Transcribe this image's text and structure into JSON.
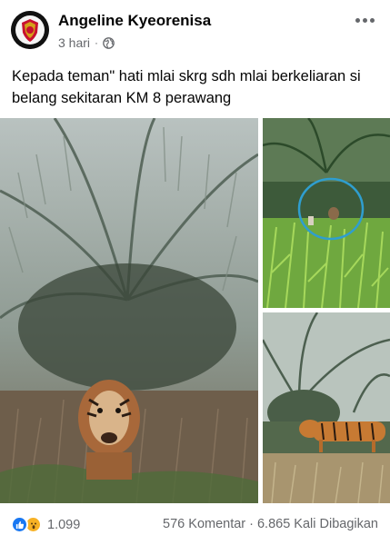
{
  "post": {
    "author": "Angeline Kyeorenisa",
    "time": "3 hari",
    "separator": "·",
    "text": "Kepada teman\" hati mlai skrg sdh mlai berkeliaran si belang sekitaran KM 8 perawang"
  },
  "icons": {
    "avatar": "police-badge-avatar",
    "privacy": "globe-icon",
    "options": "more-options-icon",
    "like": "like-reaction-icon",
    "wow": "wow-reaction-icon"
  },
  "colors": {
    "like_blue": "#1877f2",
    "wow_yellow": "#f7b125",
    "secondary_text": "#65676b"
  },
  "footer": {
    "reaction_count": "1.099",
    "comments": "576 Komentar",
    "dot": "·",
    "shares": "6.865 Kali Dibagikan"
  }
}
